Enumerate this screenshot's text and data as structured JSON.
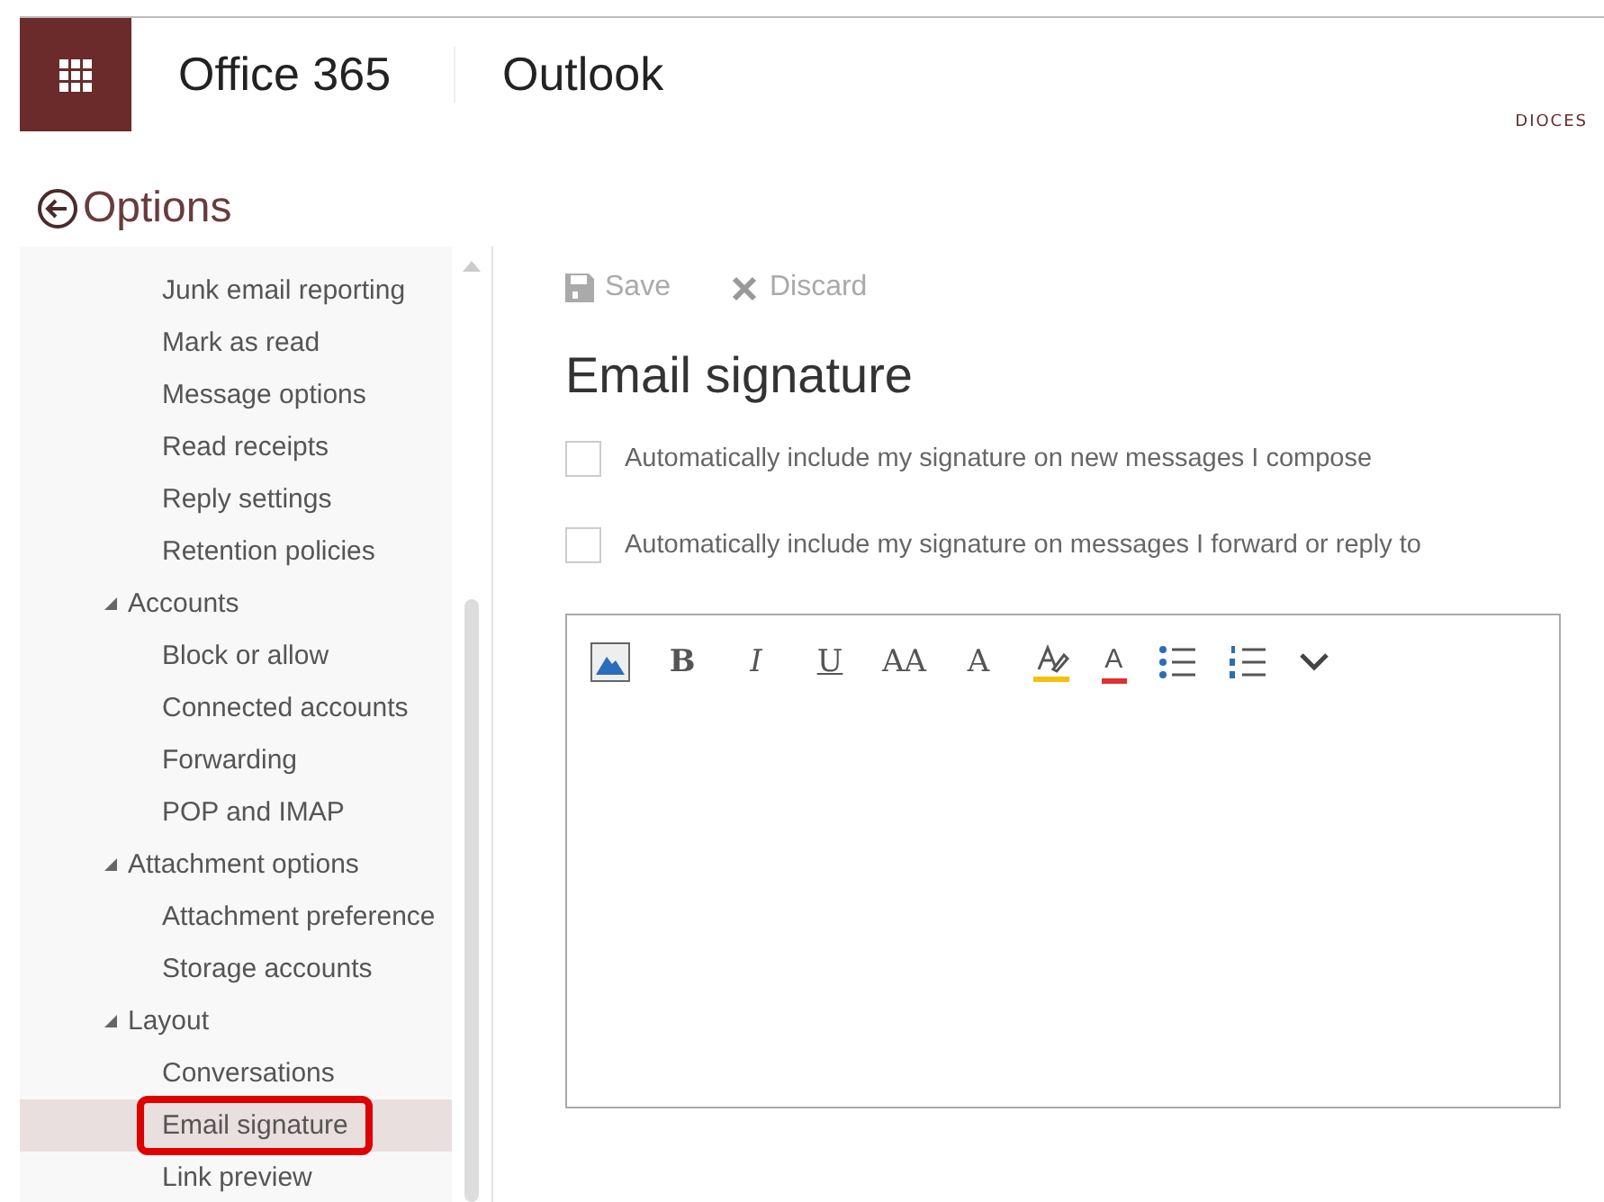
{
  "header": {
    "suite": "Office 365",
    "app": "Outlook",
    "logo": "DIOCES"
  },
  "page_title": "Options",
  "sidebar": {
    "sections": [
      {
        "children": [
          {
            "label": "Junk email reporting",
            "selected": false,
            "highlighted": false
          },
          {
            "label": "Mark as read",
            "selected": false,
            "highlighted": false
          },
          {
            "label": "Message options",
            "selected": false,
            "highlighted": false
          },
          {
            "label": "Read receipts",
            "selected": false,
            "highlighted": false
          },
          {
            "label": "Reply settings",
            "selected": false,
            "highlighted": false
          },
          {
            "label": "Retention policies",
            "selected": false,
            "highlighted": false
          }
        ]
      },
      {
        "label": "Accounts",
        "expanded": true,
        "children": [
          {
            "label": "Block or allow",
            "selected": false,
            "highlighted": false
          },
          {
            "label": "Connected accounts",
            "selected": false,
            "highlighted": false
          },
          {
            "label": "Forwarding",
            "selected": false,
            "highlighted": false
          },
          {
            "label": "POP and IMAP",
            "selected": false,
            "highlighted": false
          }
        ]
      },
      {
        "label": "Attachment options",
        "expanded": true,
        "children": [
          {
            "label": "Attachment preference",
            "selected": false,
            "highlighted": false
          },
          {
            "label": "Storage accounts",
            "selected": false,
            "highlighted": false
          }
        ]
      },
      {
        "label": "Layout",
        "expanded": true,
        "children": [
          {
            "label": "Conversations",
            "selected": false,
            "highlighted": false
          },
          {
            "label": "Email signature",
            "selected": true,
            "highlighted": true
          },
          {
            "label": "Link preview",
            "selected": false,
            "highlighted": false
          }
        ]
      }
    ]
  },
  "actions": [
    {
      "kind": "save",
      "label": "Save",
      "disabled": true
    },
    {
      "kind": "discard",
      "label": "Discard",
      "disabled": true
    }
  ],
  "title": "Email signature",
  "options": [
    {
      "label": "Automatically include my signature on new messages I compose",
      "checked": false
    },
    {
      "label": "Automatically include my signature on messages I forward or reply to",
      "checked": false
    }
  ],
  "toolbar": [
    {
      "kind": "picture"
    },
    {
      "kind": "bold",
      "label": "B"
    },
    {
      "kind": "italic",
      "label": "I"
    },
    {
      "kind": "underline",
      "label": "U"
    },
    {
      "kind": "size",
      "label": "AA"
    },
    {
      "kind": "grow",
      "label": "A"
    },
    {
      "kind": "highlight"
    },
    {
      "kind": "fontcolor",
      "label": "A"
    },
    {
      "kind": "bullets"
    },
    {
      "kind": "numbering"
    },
    {
      "kind": "more"
    }
  ]
}
